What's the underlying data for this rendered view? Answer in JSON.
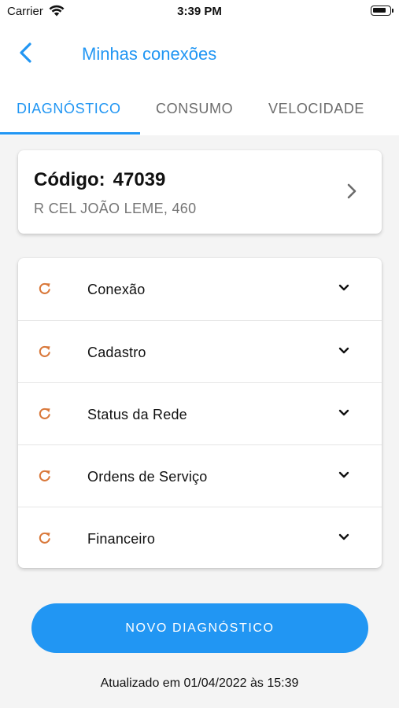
{
  "status_bar": {
    "carrier": "Carrier",
    "time": "3:39 PM",
    "wifi_icon": "wifi-icon",
    "battery_icon": "battery-icon"
  },
  "nav": {
    "title": "Minhas conexões",
    "back_icon": "chevron-left-icon"
  },
  "tabs": [
    {
      "label": "DIAGNÓSTICO",
      "active": true
    },
    {
      "label": "CONSUMO",
      "active": false
    },
    {
      "label": "VELOCIDADE",
      "active": false
    }
  ],
  "connection": {
    "code_label": "Código:",
    "code_value": "47039",
    "address": "R CEL JOÃO LEME, 460",
    "chevron_icon": "chevron-right-icon"
  },
  "diagnostics": [
    {
      "label": "Conexão",
      "icon": "refresh-icon"
    },
    {
      "label": "Cadastro",
      "icon": "refresh-icon"
    },
    {
      "label": "Status da Rede",
      "icon": "refresh-icon"
    },
    {
      "label": "Ordens de Serviço",
      "icon": "refresh-icon"
    },
    {
      "label": "Financeiro",
      "icon": "refresh-icon"
    }
  ],
  "primary_button": {
    "label": "NOVO DIAGNÓSTICO"
  },
  "footer": {
    "updated_text": "Atualizado em 01/04/2022 às 15:39"
  },
  "colors": {
    "accent": "#2196f3",
    "refresh_icon": "#d9783a",
    "muted_text": "#757575",
    "background": "#f4f4f4"
  }
}
